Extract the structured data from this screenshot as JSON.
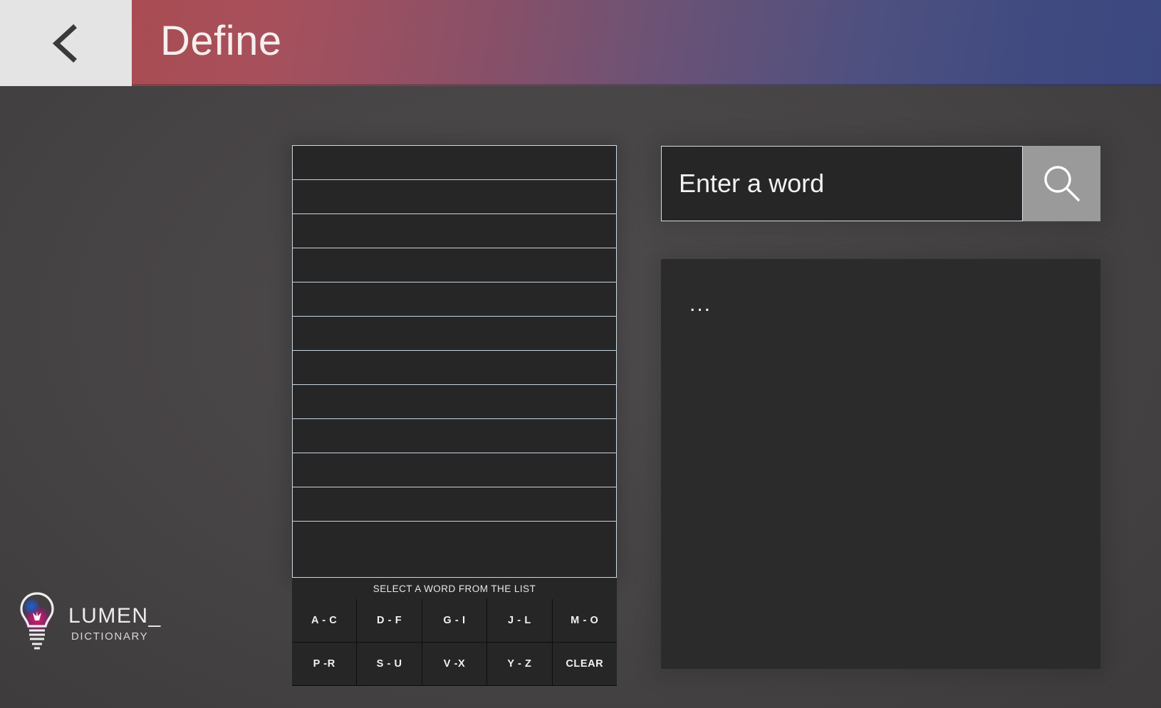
{
  "header": {
    "back_icon": "chevron-left-icon",
    "title": "Define"
  },
  "word_list": {
    "rows": [
      "",
      "",
      "",
      "",
      "",
      "",
      "",
      "",
      "",
      "",
      "",
      ""
    ],
    "hint": "SELECT A WORD FROM THE LIST"
  },
  "keypad": {
    "keys": [
      {
        "label": "A - C"
      },
      {
        "label": "D - F"
      },
      {
        "label": "G - I"
      },
      {
        "label": "J - L"
      },
      {
        "label": "M - O"
      },
      {
        "label": "P -R"
      },
      {
        "label": "S - U"
      },
      {
        "label": "V -X"
      },
      {
        "label": "Y - Z"
      },
      {
        "label": "CLEAR"
      }
    ]
  },
  "search": {
    "placeholder": "Enter a word",
    "value": "",
    "button_icon": "search-icon"
  },
  "definition": {
    "text": "..."
  },
  "logo": {
    "icon": "lightbulb-icon",
    "name": "LUMEN_",
    "subtitle": "DICTIONARY"
  },
  "colors": {
    "header_gradient_start": "#a94c52",
    "header_gradient_end": "#3c4780",
    "back_button_bg": "#e4e4e4",
    "panel_bg": "#262626",
    "page_bg": "#474445",
    "row_divider": "#c7d4e0",
    "search_button_bg": "#9a9a9a",
    "logo_accent_pink": "#d9186b",
    "logo_accent_blue": "#1f63c9"
  }
}
